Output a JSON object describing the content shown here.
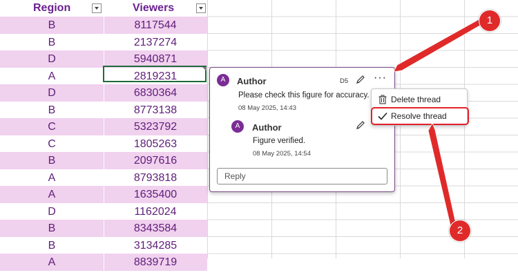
{
  "sheet": {
    "headers": {
      "region": "Region",
      "viewers": "Viewers"
    },
    "rows": [
      {
        "region": "B",
        "viewers": "8117544"
      },
      {
        "region": "B",
        "viewers": "2137274"
      },
      {
        "region": "D",
        "viewers": "5940871"
      },
      {
        "region": "A",
        "viewers": "2819231"
      },
      {
        "region": "D",
        "viewers": "6830364"
      },
      {
        "region": "B",
        "viewers": "8773138"
      },
      {
        "region": "C",
        "viewers": "5323792"
      },
      {
        "region": "C",
        "viewers": "1805263"
      },
      {
        "region": "B",
        "viewers": "2097616"
      },
      {
        "region": "A",
        "viewers": "8793818"
      },
      {
        "region": "A",
        "viewers": "1635400"
      },
      {
        "region": "D",
        "viewers": "1162024"
      },
      {
        "region": "B",
        "viewers": "8343584"
      },
      {
        "region": "B",
        "viewers": "3134285"
      },
      {
        "region": "A",
        "viewers": "8839719"
      }
    ],
    "band_color": "#f0d1ee",
    "text_color": "#5f1d79"
  },
  "comment": {
    "author_initial": "A",
    "author": "Author",
    "cell_ref": "D5",
    "text": "Please check this figure for accuracy.",
    "time": "08 May 2025, 14:43",
    "reply": {
      "author_initial": "A",
      "author": "Author",
      "text": "Figure verified.",
      "time": "08 May 2025, 14:54"
    },
    "reply_placeholder": "Reply",
    "more_label": "···"
  },
  "menu": {
    "items": [
      {
        "label": "Delete thread",
        "icon": "trash-icon"
      },
      {
        "label": "Resolve thread",
        "icon": "checkmark-icon"
      }
    ]
  },
  "annotations": {
    "badge1": "1",
    "badge2": "2",
    "color": "#e02a2a"
  }
}
